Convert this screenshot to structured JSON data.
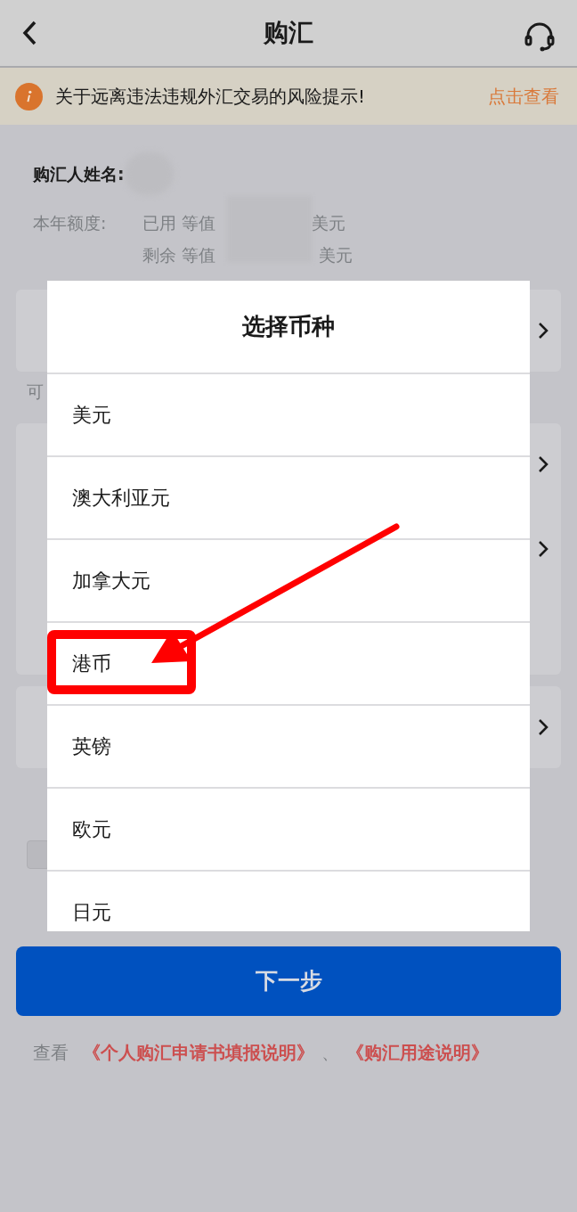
{
  "header": {
    "title": "购汇"
  },
  "notice": {
    "text": "关于远离违法违规外汇交易的风险提示!",
    "link": "点击查看"
  },
  "buyer": {
    "label": "购汇人姓名:"
  },
  "quota": {
    "label": "本年额度:",
    "lines": [
      {
        "prefix": "已用 等值",
        "unit": "美元"
      },
      {
        "prefix": "剩余 等值",
        "unit": "美元"
      }
    ]
  },
  "sections": [
    {
      "kind": "card",
      "rows": [
        {
          "kind": "select"
        }
      ]
    },
    {
      "kind": "hint",
      "text": "可"
    },
    {
      "kind": "card",
      "rows": [
        {
          "kind": "select"
        },
        {
          "kind": "select"
        },
        {
          "kind": "input"
        }
      ]
    },
    {
      "kind": "card",
      "rows": [
        {
          "kind": "select"
        }
      ]
    },
    {
      "kind": "checkbox",
      "checked": false
    }
  ],
  "dialog": {
    "title": "选择币种",
    "items": [
      {
        "label": "美元",
        "highlighted": false
      },
      {
        "label": "澳大利亚元",
        "highlighted": false
      },
      {
        "label": "加拿大元",
        "highlighted": false
      },
      {
        "label": "港币",
        "highlighted": true
      },
      {
        "label": "英镑",
        "highlighted": false
      },
      {
        "label": "欧元",
        "highlighted": false
      },
      {
        "label": "日元",
        "highlighted": false
      }
    ]
  },
  "next_button": "下一步",
  "footer": {
    "prefix": "查看",
    "links": [
      "《个人购汇申请书填报说明》",
      "《购汇用途说明》"
    ],
    "separator": "、"
  }
}
